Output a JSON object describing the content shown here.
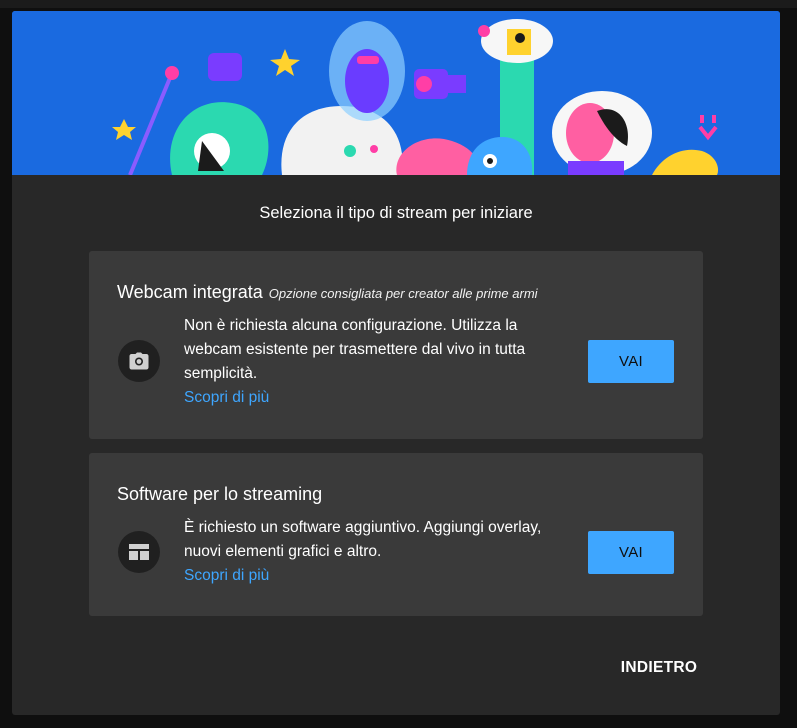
{
  "dialog": {
    "heading": "Seleziona il tipo di stream per iniziare",
    "back_label": "INDIETRO"
  },
  "options": [
    {
      "title": "Webcam integrata",
      "subtitle": "Opzione consigliata per creator alle prime armi",
      "description": "Non è richiesta alcuna configurazione. Utilizza la webcam esistente per trasmettere dal vivo in tutta semplicità.",
      "learn_more": "Scopri di più",
      "button_label": "VAI",
      "icon": "camera-icon"
    },
    {
      "title": "Software per lo streaming",
      "subtitle": "",
      "description": "È richiesto un software aggiuntivo. Aggiungi overlay, nuovi elementi grafici e altro.",
      "learn_more": "Scopri di più",
      "button_label": "VAI",
      "icon": "layout-icon"
    }
  ],
  "colors": {
    "accent": "#3ea6ff",
    "banner": "#1a6ae0",
    "card": "#3a3a3a",
    "dialog": "#282828"
  }
}
